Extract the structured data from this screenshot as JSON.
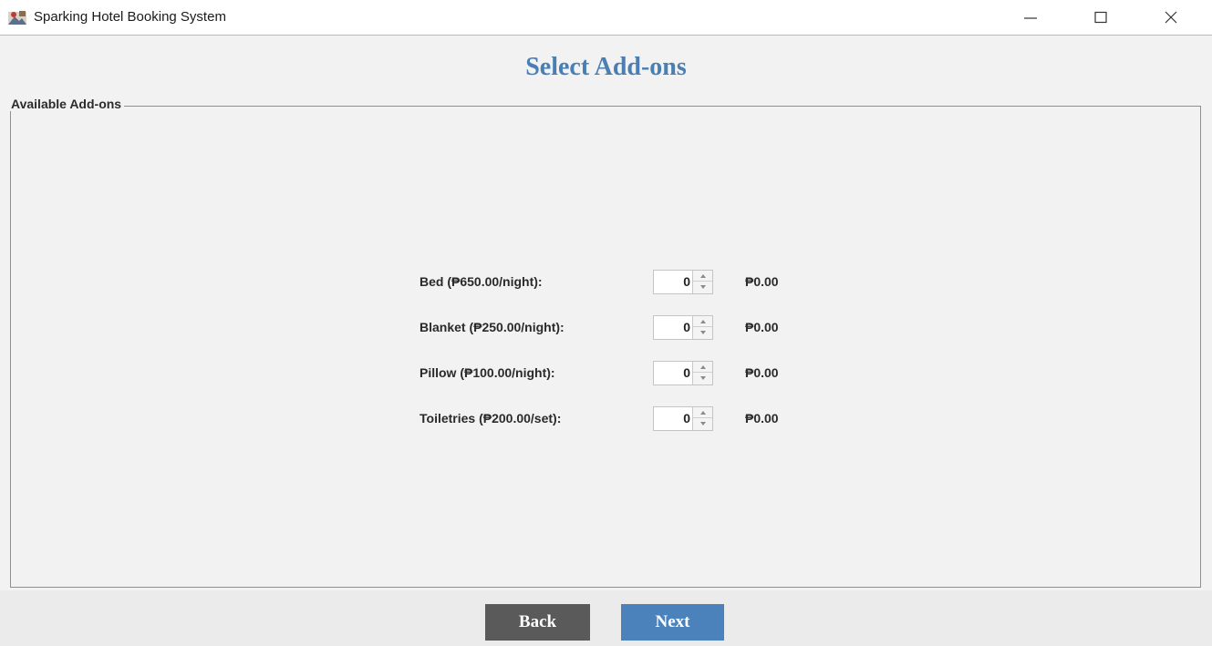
{
  "window": {
    "title": "Sparking Hotel Booking System",
    "controls": [
      "minimize-icon",
      "maximize-icon",
      "close-icon"
    ]
  },
  "page": {
    "title": "Select Add-ons"
  },
  "addons": {
    "group_label": "Available Add-ons",
    "items": [
      {
        "label": "Bed (₱650.00/night):",
        "quantity": "0",
        "price": "₱0.00"
      },
      {
        "label": "Blanket (₱250.00/night):",
        "quantity": "0",
        "price": "₱0.00"
      },
      {
        "label": "Pillow (₱100.00/night):",
        "quantity": "0",
        "price": "₱0.00"
      },
      {
        "label": "Toiletries (₱200.00/set):",
        "quantity": "0",
        "price": "₱0.00"
      }
    ]
  },
  "footer": {
    "back_label": "Back",
    "next_label": "Next"
  },
  "colors": {
    "title_blue": "#4a7fb4",
    "back_button": "#5a5a5a",
    "next_button": "#4b82bc",
    "background": "#f2f2f2"
  }
}
